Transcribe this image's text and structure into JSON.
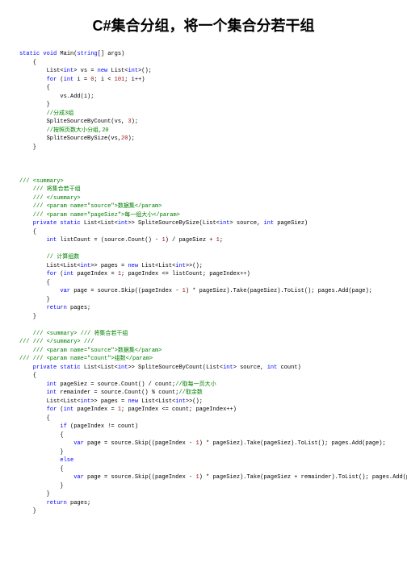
{
  "title": "C#集合分组，将一个集合分若干组",
  "code": {
    "l1a": "static",
    "l1b": "void",
    "l1c": " Main(",
    "l1d": "string",
    "l1e": "[] args)",
    "l2": "    {",
    "l3a": "        List<",
    "l3b": "int",
    "l3c": "> vs = ",
    "l3d": "new",
    "l3e": " List<",
    "l3f": "int",
    "l3g": ">();",
    "l4a": "        for",
    "l4b": " (",
    "l4c": "int",
    "l4d": " i = ",
    "l4e": "0",
    "l4f": "; i < ",
    "l4g": "101",
    "l4h": "; i++)",
    "l5": "        {",
    "l6": "            vs.Add(i);",
    "l7": "        }",
    "l8": "        //分成3组",
    "l9a": "        SpliteSourceByCount(vs, ",
    "l9b": "3",
    "l9c": ");",
    "l10": "        //按照页数大小分组,20",
    "l11a": "        SpliteSourceBySize(vs,",
    "l11b": "20",
    "l11c": ");",
    "l12": "    }",
    "l20": "/// <summary>",
    "l21": "    /// 将集合若干组",
    "l22": "    /// </summary>",
    "l23a": "    /// <param name=\"source\">",
    "l23b": "数据集",
    "l23c": "</param>",
    "l24a": "    /// <param name=\"pageSiez\">",
    "l24b": "每一组大小",
    "l24c": "</param>",
    "l25a": "    private",
    "l25b": " static",
    "l25c": " List<List<",
    "l25d": "int",
    "l25e": ">> SpliteSourceBySize(List<",
    "l25f": "int",
    "l25g": "> source, ",
    "l25h": "int",
    "l25i": " pageSiez)",
    "l26": "    {",
    "l27a": "        int",
    "l27b": " listCount = (source.Count() - ",
    "l27c": "1",
    "l27d": ") / pageSiez + ",
    "l27e": "1",
    "l27f": ";",
    "l29": "        // 计算组数",
    "l30a": "        List<List<",
    "l30b": "int",
    "l30c": ">> pages = ",
    "l30d": "new",
    "l30e": " List<List<",
    "l30f": "int",
    "l30g": ">>();",
    "l31a": "        for",
    "l31b": " (",
    "l31c": "int",
    "l31d": " pageIndex = ",
    "l31e": "1",
    "l31f": "; pageIndex <= listCount; pageIndex++)",
    "l32": "        {",
    "l33a": "            var",
    "l33b": " page = source.Skip((pageIndex - ",
    "l33c": "1",
    "l33d": ") * pageSiez).Take(pageSiez).ToList(); pages.Add(page);",
    "l34": "        }",
    "l35a": "        return",
    "l35b": " pages;",
    "l36": "    }",
    "l40a": "    /// <summary> ",
    "l40b": "/// 将集合若干组",
    "l41": "/// /// </summary> ///",
    "l42a": "    /// <param name=\"source\">",
    "l42b": "数据集",
    "l42c": "</param>",
    "l43a": "/// /// <param name=\"count\">",
    "l43b": "组数",
    "l43c": "</param>",
    "l44a": "    private",
    "l44b": " static",
    "l44c": " List<List<",
    "l44d": "int",
    "l44e": ">> SpliteSourceByCount(List<",
    "l44f": "int",
    "l44g": "> source, ",
    "l44h": "int",
    "l44i": " count)",
    "l45": "    {",
    "l46a": "        int",
    "l46b": " pageSiez = source.Count() / count;",
    "l46c": "//取每一页大小",
    "l47a": "        int",
    "l47b": " remainder = source.Count() % count;",
    "l47c": "//取余数",
    "l48a": "        List<List<",
    "l48b": "int",
    "l48c": ">> pages = ",
    "l48d": "new",
    "l48e": " List<List<",
    "l48f": "int",
    "l48g": ">>();",
    "l49a": "        for",
    "l49b": " (",
    "l49c": "int",
    "l49d": " pageIndex = ",
    "l49e": "1",
    "l49f": "; pageIndex <= count; pageIndex++)",
    "l50": "        {",
    "l51a": "            if",
    "l51b": " (pageIndex != count)",
    "l52": "            {",
    "l53a": "                var",
    "l53b": " page = source.Skip((pageIndex - ",
    "l53c": "1",
    "l53d": ") * pageSiez).Take(pageSiez).ToList(); pages.Add(page);",
    "l54": "            }",
    "l55": "            else",
    "l56": "            {",
    "l57a": "                var",
    "l57b": " page = source.Skip((pageIndex - ",
    "l57c": "1",
    "l57d": ") * pageSiez).Take(pageSiez + remainder).ToList(); pages.Add(page);",
    "l58": "            }",
    "l59": "        }",
    "l60a": "        return",
    "l60b": " pages;",
    "l61": "    }"
  }
}
